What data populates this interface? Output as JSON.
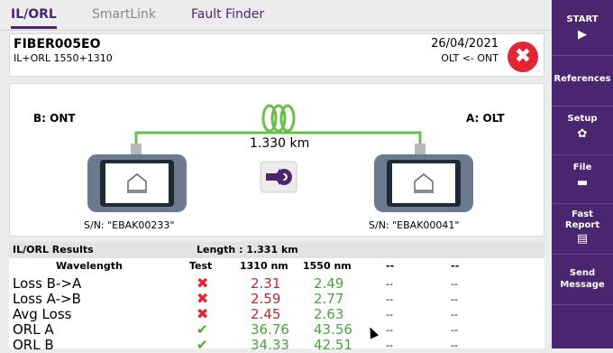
{
  "tabs": [
    {
      "label": "IL/ORL"
    },
    {
      "label": "SmartLink"
    },
    {
      "label": "Fault Finder"
    }
  ],
  "header": {
    "title": "FIBER005EO",
    "subtitle": "IL+ORL 1550+1310",
    "date": "26/04/2021",
    "direction": "OLT <- ONT",
    "close_icon": "✖"
  },
  "diagram": {
    "left_label": "B: ONT",
    "right_label": "A: OLT",
    "distance": "1.330 km",
    "left_sn": "S/N: \"EBAK00233\"",
    "right_sn": "S/N: \"EBAK00041\"",
    "fiber_color": "#6abf4b"
  },
  "results": {
    "title": "IL/ORL Results",
    "length": "Length : 1.331 km",
    "columns": [
      "Wavelength",
      "Test",
      "1310 nm",
      "1550 nm",
      "--",
      "--"
    ],
    "rows": [
      {
        "label": "Loss B->A",
        "status": "fail",
        "v1310": "2.31",
        "v1550": "2.49",
        "c5": "--",
        "c6": "--",
        "c1310": "red",
        "c1550": "green"
      },
      {
        "label": "Loss A->B",
        "status": "fail",
        "v1310": "2.59",
        "v1550": "2.77",
        "c5": "--",
        "c6": "--",
        "c1310": "red",
        "c1550": "green"
      },
      {
        "label": "Avg Loss",
        "status": "fail",
        "v1310": "2.45",
        "v1550": "2.63",
        "c5": "--",
        "c6": "--",
        "c1310": "red",
        "c1550": "green"
      },
      {
        "label": "ORL A",
        "status": "pass",
        "v1310": "36.76",
        "v1550": "43.56",
        "c5": "--",
        "c6": "--",
        "c1310": "green",
        "c1550": "green"
      },
      {
        "label": "ORL B",
        "status": "pass",
        "v1310": "34.33",
        "v1550": "42.51",
        "c5": "--",
        "c6": "--",
        "c1310": "green",
        "c1550": "green"
      }
    ]
  },
  "sidebar": {
    "start": {
      "label": "START",
      "icon": "▶"
    },
    "references": {
      "label": "References"
    },
    "setup": {
      "label": "Setup",
      "icon": "✿"
    },
    "file": {
      "label": "File",
      "icon": "▬"
    },
    "fast_report": {
      "label": "Fast Report",
      "icon": "▤"
    },
    "send_message": {
      "label": "Send Message"
    }
  },
  "colors": {
    "accent": "#4a2570",
    "fail": "#e32636",
    "pass": "#4aa33b"
  }
}
